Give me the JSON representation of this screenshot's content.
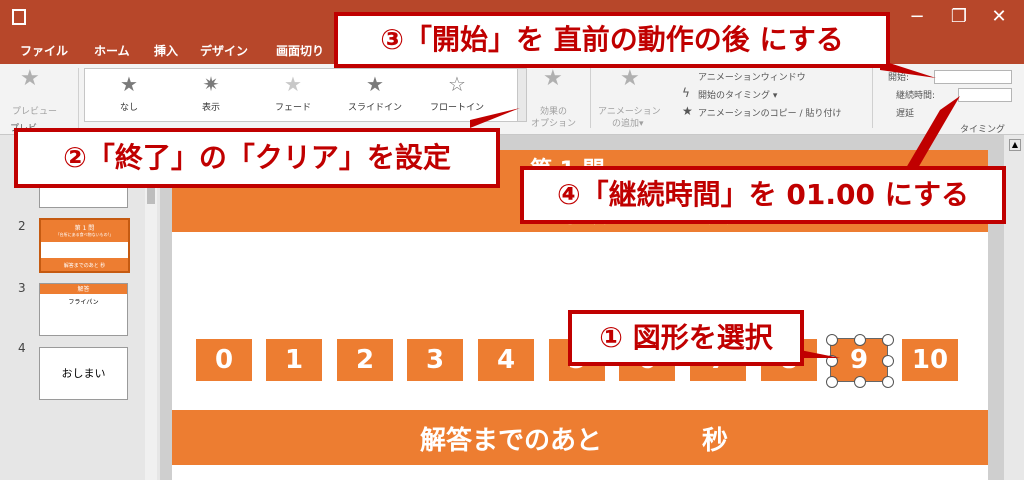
{
  "window": {
    "minimize_glyph": "−",
    "restore_glyph": "❐",
    "close_glyph": "✕"
  },
  "tabs": [
    "ファイル",
    "ホーム",
    "挿入",
    "デザイン",
    "画面切り"
  ],
  "ribbon": {
    "preview_label": "プレビュー",
    "preview_group": "プレビ",
    "gallery": [
      "なし",
      "表示",
      "フェード",
      "スライドイン",
      "フロートイン"
    ],
    "effect_options": [
      "効果の",
      "オプション"
    ],
    "add_animation": [
      "アニメーション",
      "の追加▾"
    ],
    "anim_window": "アニメーションウィンドウ",
    "timing_trigger": "開始のタイミング ▾",
    "anim_copy": "アニメーションのコピー / 貼り付け",
    "start_label": "開始:",
    "duration_label": "継続時間:",
    "delay_label": "遅延",
    "timing_group": "タイミング"
  },
  "slides": {
    "numbers": [
      "2",
      "3",
      "4"
    ],
    "thumb2_title": "第 1 問",
    "thumb2_sub": "「台所にある食べ物ないもの!」",
    "thumb2_footer": "解答までのあと 秒",
    "thumb3_title": "解答",
    "thumb3_body": "フライパン",
    "thumb4_body": "おしまい"
  },
  "slide": {
    "header_partial": "第 1 問",
    "title": "「台所にある食",
    "numbers": [
      "0",
      "1",
      "2",
      "3",
      "4",
      "5",
      "6",
      "7",
      "8",
      "9",
      "10"
    ],
    "footer_left": "解答までのあと",
    "footer_right": "秒"
  },
  "callouts": {
    "c1": "① 図形を選択",
    "c2": "②「終了」の「クリア」を設定",
    "c3": "③「開始」を 直前の動作の後 にする",
    "c4": "④「継続時間」を 01.00 にする"
  },
  "colors": {
    "accent": "#b7472a",
    "slide_orange": "#ed7d31",
    "callout_red": "#c00000"
  }
}
